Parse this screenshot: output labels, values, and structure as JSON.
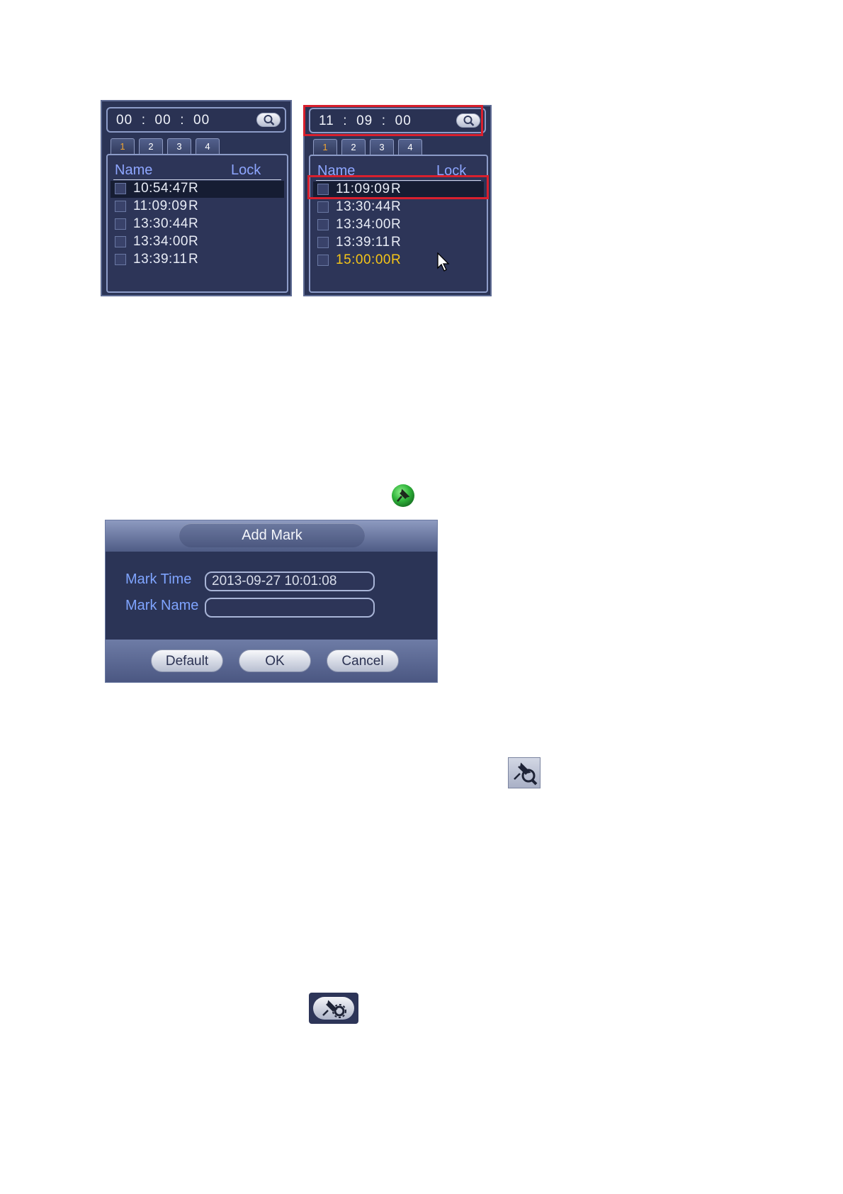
{
  "left_panel": {
    "time": "00  :  00  :  00",
    "tabs": [
      "1",
      "2",
      "3",
      "4"
    ],
    "col_name": "Name",
    "col_lock": "Lock",
    "rows": [
      {
        "time": "10:54:47",
        "lock": "R"
      },
      {
        "time": "11:09:09",
        "lock": "R"
      },
      {
        "time": "13:30:44",
        "lock": "R"
      },
      {
        "time": "13:34:00",
        "lock": "R"
      },
      {
        "time": "13:39:11",
        "lock": "R"
      }
    ]
  },
  "right_panel": {
    "time": "11  :  09  :  00",
    "tabs": [
      "1",
      "2",
      "3",
      "4"
    ],
    "col_name": "Name",
    "col_lock": "Lock",
    "rows": [
      {
        "time": "11:09:09",
        "lock": "R"
      },
      {
        "time": "13:30:44",
        "lock": "R"
      },
      {
        "time": "13:34:00",
        "lock": "R"
      },
      {
        "time": "13:39:11",
        "lock": "R"
      },
      {
        "time": "15:00:00",
        "lock": "R"
      }
    ]
  },
  "add_mark_dialog": {
    "title": "Add Mark",
    "mark_time_label": "Mark Time",
    "mark_time_value": "2013-09-27 10:01:08",
    "mark_name_label": "Mark Name",
    "mark_name_value": "",
    "buttons": {
      "default": "Default",
      "ok": "OK",
      "cancel": "Cancel"
    }
  },
  "colors": {
    "panel_bg": "#2b3456",
    "header_text": "#8ea6ff",
    "highlight_text": "#f5c518",
    "active_tab_text": "#f2a531",
    "annotation_red": "#d8202e"
  },
  "icons": [
    "search-icon",
    "add-mark-pin-icon",
    "search-mark-icon",
    "mark-manager-icon",
    "mouse-cursor-icon"
  ]
}
